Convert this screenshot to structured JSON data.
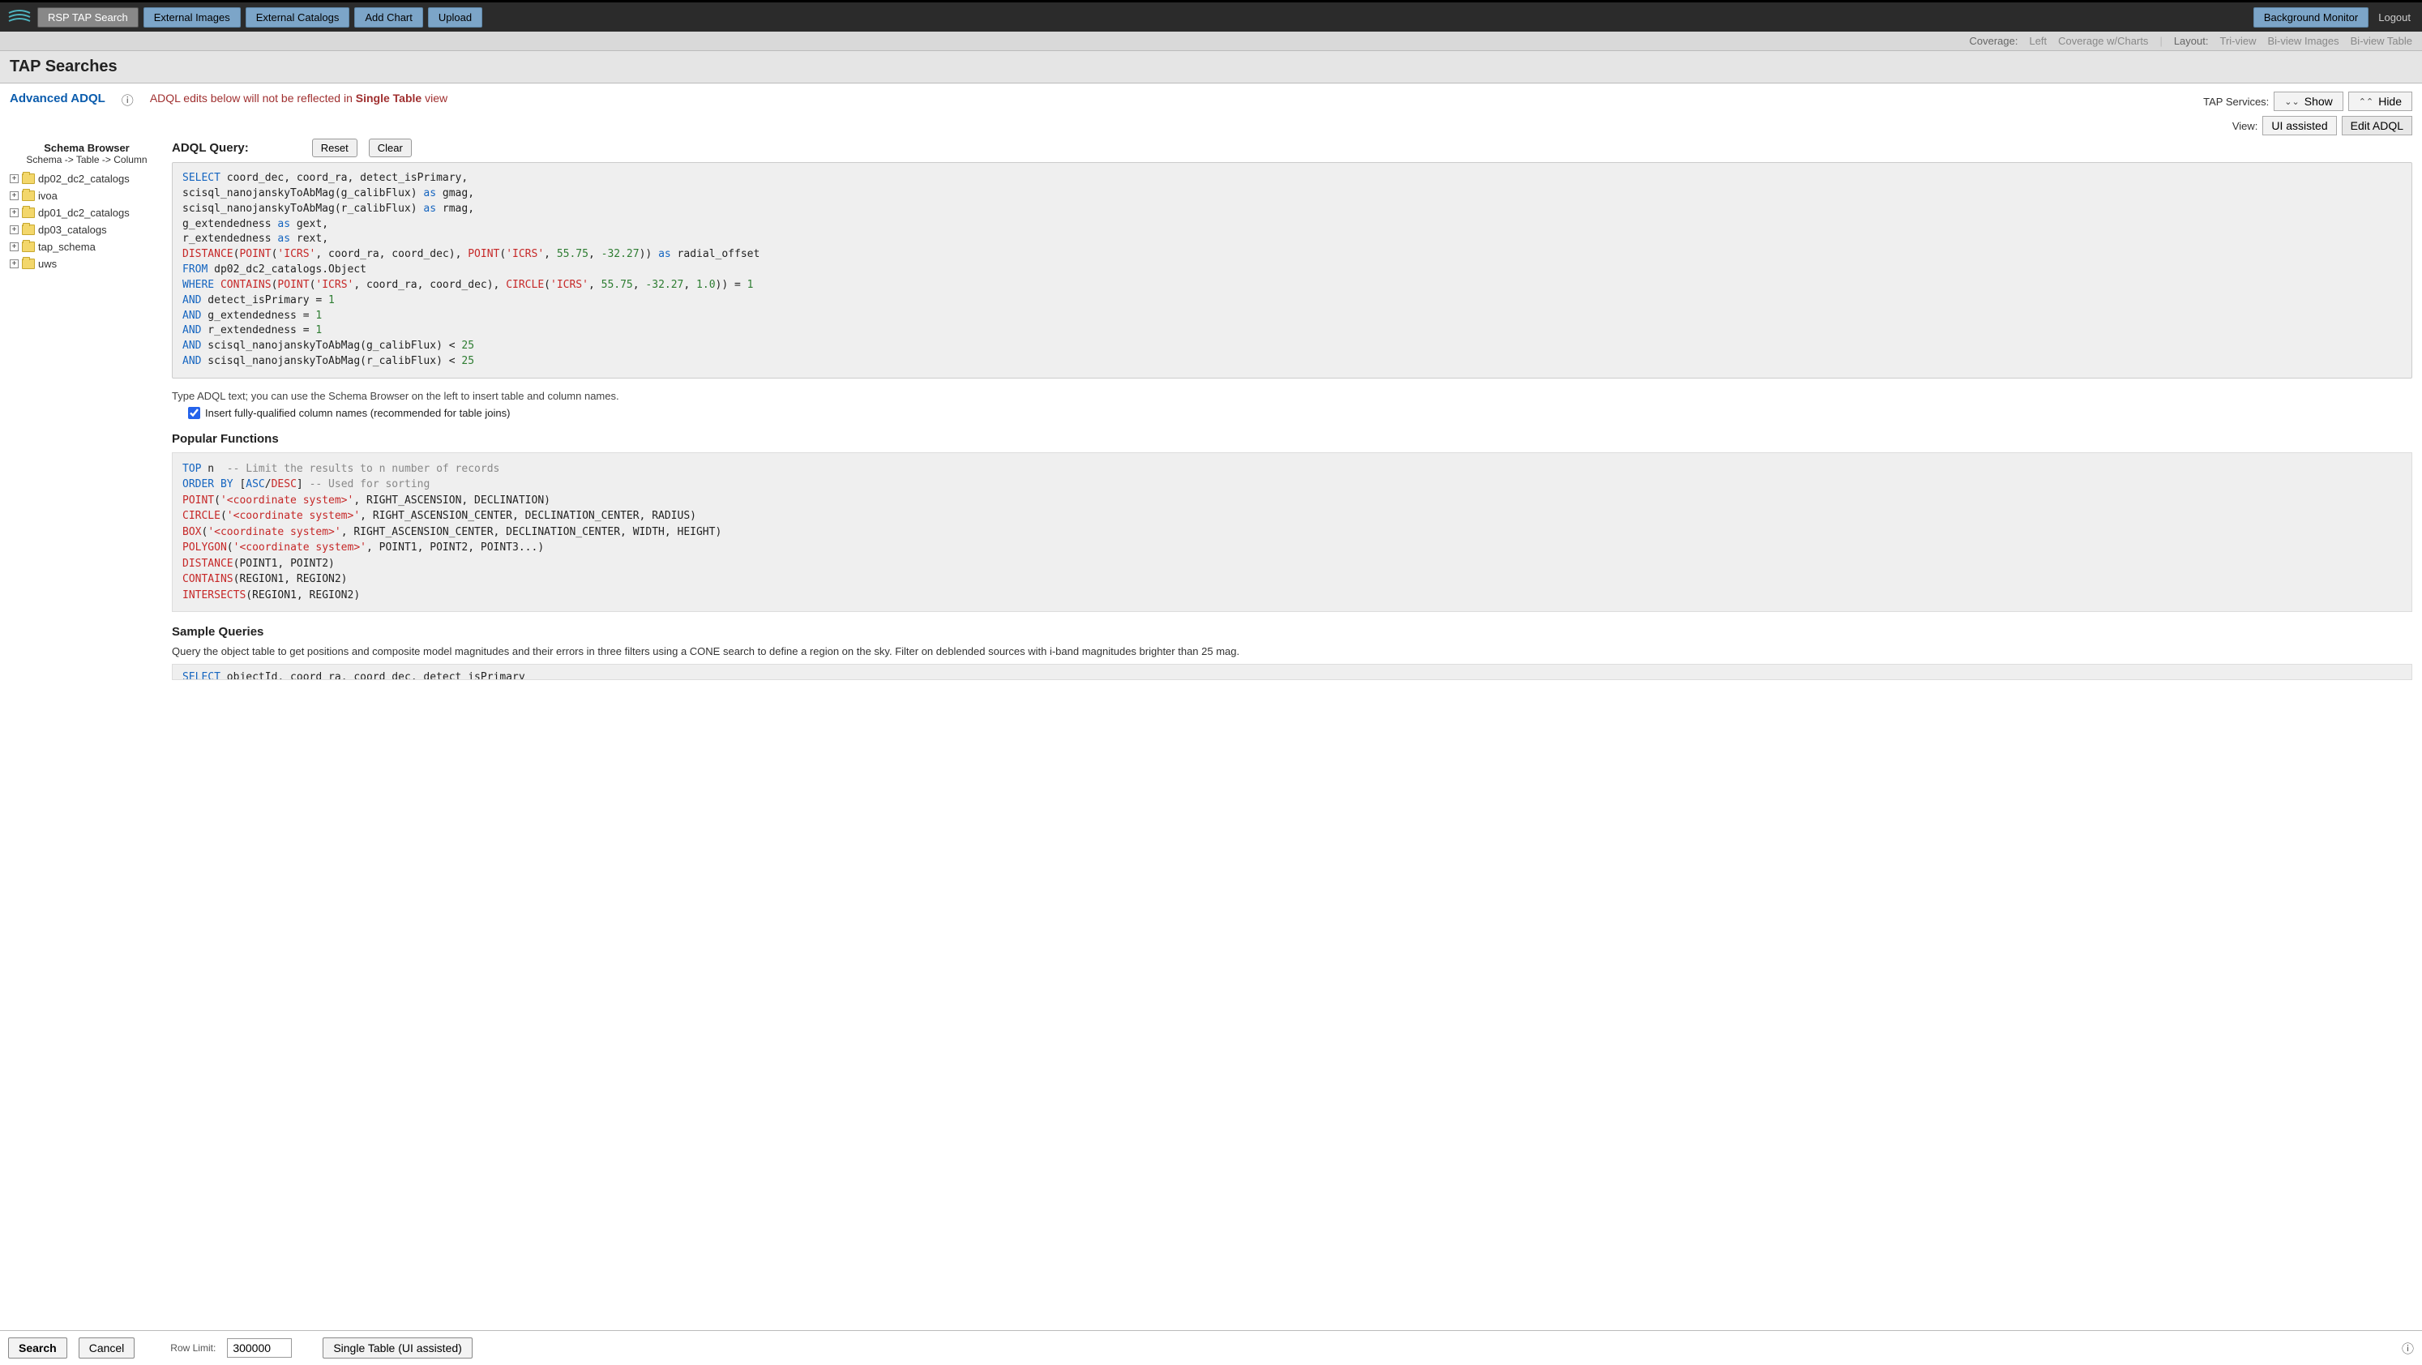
{
  "topbar": {
    "buttons": [
      "RSP TAP Search",
      "External Images",
      "External Catalogs",
      "Add Chart",
      "Upload"
    ],
    "active_index": 0,
    "bg_monitor": "Background Monitor",
    "logout": "Logout"
  },
  "secbar": {
    "coverage_lbl": "Coverage:",
    "coverage_opts": [
      "Left",
      "Coverage w/Charts"
    ],
    "layout_lbl": "Layout:",
    "layout_opts": [
      "Tri-view",
      "Bi-view Images",
      "Bi-view Table"
    ]
  },
  "title": "TAP Searches",
  "adv_link": "Advanced ADQL",
  "edit_warn_prefix": "ADQL edits below will not be reflected in ",
  "edit_warn_bold": "Single Table",
  "edit_warn_suffix": " view",
  "services": {
    "tap_lbl": "TAP Services:",
    "show": "Show",
    "hide": "Hide",
    "view_lbl": "View:",
    "ui_assisted": "UI assisted",
    "edit_adql": "Edit ADQL"
  },
  "sidebar": {
    "title": "Schema Browser",
    "sub": "Schema -> Table -> Column",
    "items": [
      "dp02_dc2_catalogs",
      "ivoa",
      "dp01_dc2_catalogs",
      "dp03_catalogs",
      "tap_schema",
      "uws"
    ]
  },
  "query": {
    "title": "ADQL Query:",
    "reset": "Reset",
    "clear": "Clear"
  },
  "hint": "Type ADQL text; you can use the Schema Browser on the left to insert table and column names.",
  "chk_label": "Insert fully-qualified column names (recommended for table joins)",
  "chk_checked": true,
  "popular_title": "Popular Functions",
  "sample_title": "Sample Queries",
  "sample_desc": "Query the object table to get positions and composite model magnitudes and their errors in three filters using a CONE search to define a region on the sky. Filter on deblended sources with i-band magnitudes brighter than 25 mag.",
  "bottom": {
    "search": "Search",
    "cancel": "Cancel",
    "rowlim_lbl": "Row Limit:",
    "rowlim_val": "300000",
    "single_table": "Single Table (UI assisted)"
  }
}
